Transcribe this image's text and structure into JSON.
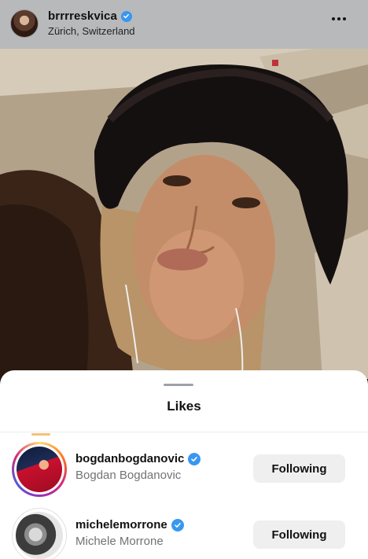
{
  "post": {
    "username": "brrrreskvica",
    "location": "Zürich, Switzerland",
    "verified": true
  },
  "sheet": {
    "title": "Likes"
  },
  "likes": [
    {
      "username": "bogdanbogdanovic",
      "full_name": "Bogdan Bogdanovic",
      "verified": true,
      "button_label": "Following",
      "has_story": true
    },
    {
      "username": "michelemorrone",
      "full_name": "Michele Morrone",
      "verified": true,
      "button_label": "Following",
      "has_story": false
    }
  ],
  "colors": {
    "verified_badge": "#3897f0",
    "header_bg": "#b8b9bb",
    "button_bg": "#efefef",
    "secondary_text": "#737373"
  },
  "icons": {
    "verified": "verified-badge-icon",
    "more": "more-horizontal-icon"
  }
}
